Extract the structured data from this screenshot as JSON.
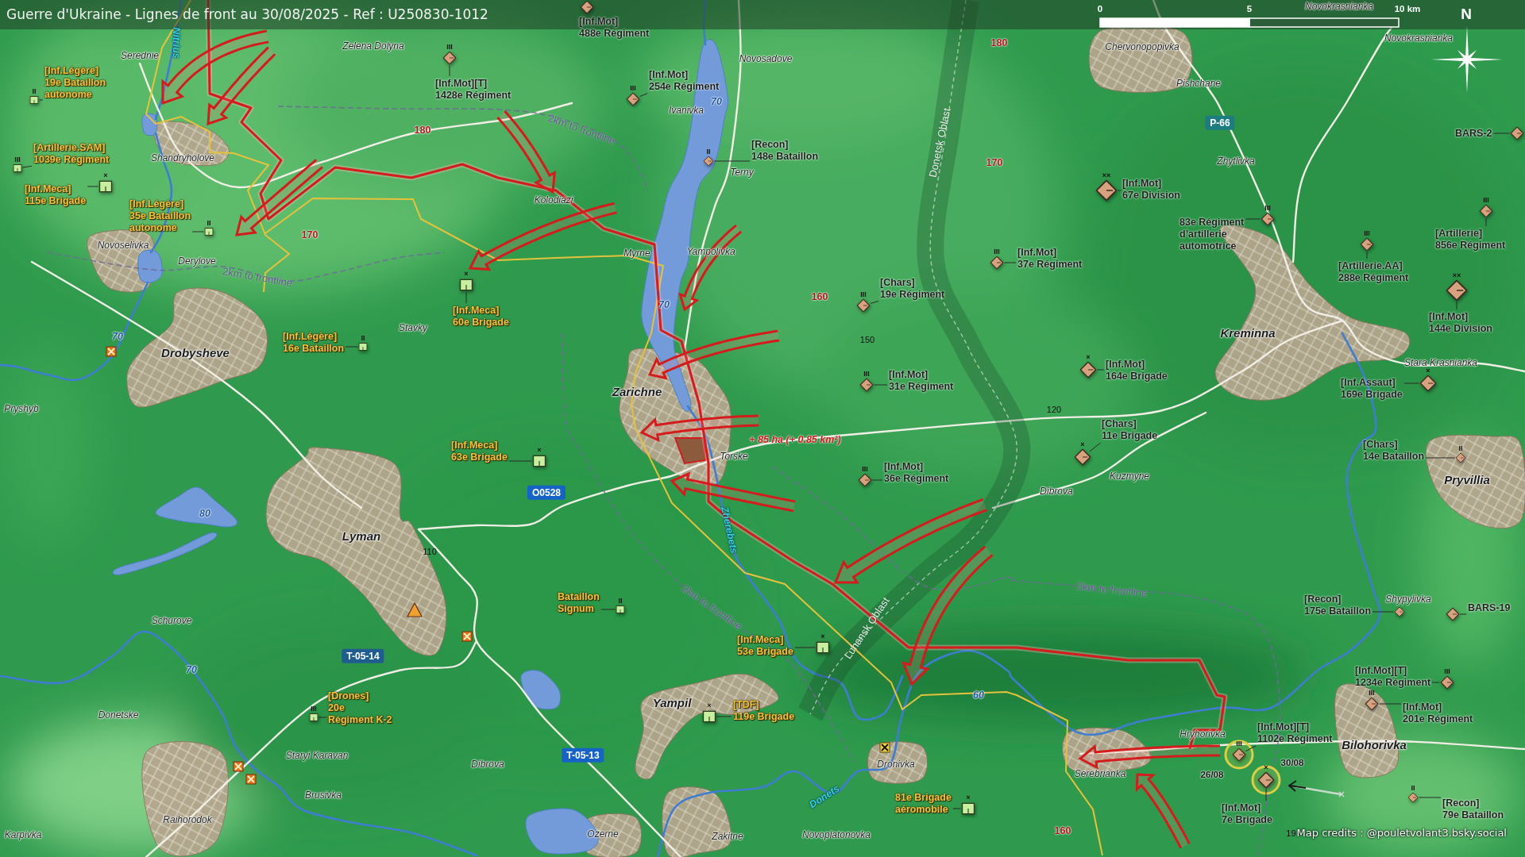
{
  "title": "Guerre d'Ukraine - Lignes de front au 30/08/2025 - Ref : U250830-1012",
  "scale_bar": {
    "ticks": [
      "0",
      "5",
      "10 km"
    ]
  },
  "compass": {
    "label": "N"
  },
  "places": [
    {
      "name": "Novokrasnianka",
      "kind": "village"
    },
    {
      "name": "Novokrasnianka",
      "kind": "village"
    },
    {
      "name": "Zelena Dolyna",
      "kind": "village"
    },
    {
      "name": "Chervonopopivka",
      "kind": "village"
    },
    {
      "name": "Serednie",
      "kind": "village"
    },
    {
      "name": "Novosadove",
      "kind": "village"
    },
    {
      "name": "Pishchane",
      "kind": "village"
    },
    {
      "name": "Ivanivka",
      "kind": "village"
    },
    {
      "name": "Shandryholove",
      "kind": "village"
    },
    {
      "name": "Zhytlivka",
      "kind": "village"
    },
    {
      "name": "Terny",
      "kind": "village"
    },
    {
      "name": "Kolodiazi",
      "kind": "village"
    },
    {
      "name": "Novoselivka",
      "kind": "village"
    },
    {
      "name": "Myrne",
      "kind": "village"
    },
    {
      "name": "Yampolivka",
      "kind": "village"
    },
    {
      "name": "Derylove",
      "kind": "village"
    },
    {
      "name": "Stavky",
      "kind": "village"
    },
    {
      "name": "Kreminna",
      "kind": "town"
    },
    {
      "name": "Drobysheve",
      "kind": "town"
    },
    {
      "name": "Stara Krasnianka",
      "kind": "village"
    },
    {
      "name": "Zarichne",
      "kind": "town"
    },
    {
      "name": "Pryshyb",
      "kind": "village"
    },
    {
      "name": "Torske",
      "kind": "village"
    },
    {
      "name": "Kuzmyne",
      "kind": "village"
    },
    {
      "name": "Pryvillia",
      "kind": "town"
    },
    {
      "name": "Dibrova",
      "kind": "village"
    },
    {
      "name": "Lyman",
      "kind": "town"
    },
    {
      "name": "Shypylivka",
      "kind": "village"
    },
    {
      "name": "Schurove",
      "kind": "village"
    },
    {
      "name": "Yampil",
      "kind": "town"
    },
    {
      "name": "Donetske",
      "kind": "village"
    },
    {
      "name": "Hryhorivka",
      "kind": "village"
    },
    {
      "name": "Bilohorivka",
      "kind": "town"
    },
    {
      "name": "Staryi Karavan",
      "kind": "village"
    },
    {
      "name": "Dibrova",
      "kind": "village"
    },
    {
      "name": "Dronivka",
      "kind": "village"
    },
    {
      "name": "Serebrianka",
      "kind": "village"
    },
    {
      "name": "Brusivka",
      "kind": "village"
    },
    {
      "name": "Raihorodok",
      "kind": "village"
    },
    {
      "name": "Karpivka",
      "kind": "village"
    },
    {
      "name": "Ozerne",
      "kind": "village"
    },
    {
      "name": "Zakitne",
      "kind": "village"
    },
    {
      "name": "Novoplatonovka",
      "kind": "village"
    }
  ],
  "russian_units": [
    {
      "kind": "medium",
      "lines": [
        "[Inf.Mot]",
        "488e Régiment"
      ],
      "highlighted": false
    },
    {
      "kind": "medium",
      "echelon": "III",
      "lines": [
        "[Inf.Mot][T]",
        "1428e Régiment"
      ],
      "highlighted": false
    },
    {
      "kind": "medium",
      "echelon": "III",
      "lines": [
        "[Inf.Mot]",
        "254e Régiment"
      ],
      "highlighted": false
    },
    {
      "kind": "medium",
      "lines": [
        "BARS-2"
      ],
      "highlighted": false
    },
    {
      "kind": "small",
      "echelon": "II",
      "lines": [
        "[Recon]",
        "148e Bataillon"
      ],
      "highlighted": false
    },
    {
      "kind": "huge",
      "echelon": "××",
      "lines": [
        "[Inf.Mot]",
        "67e Division"
      ],
      "highlighted": false
    },
    {
      "kind": "medium",
      "echelon": "III",
      "lines": [
        "83e Régiment",
        "d’artillerie",
        "automotrice"
      ],
      "highlighted": false
    },
    {
      "kind": "medium",
      "echelon": "III",
      "lines": [
        "[Artillerie]",
        "856e Régiment"
      ],
      "highlighted": false
    },
    {
      "kind": "medium",
      "echelon": "III",
      "lines": [
        "[Inf.Mot]",
        "37e Régiment"
      ],
      "highlighted": false
    },
    {
      "kind": "medium",
      "echelon": "III",
      "lines": [
        "[Artillerie.AA]",
        "288e Régiment"
      ],
      "highlighted": false
    },
    {
      "kind": "medium",
      "echelon": "III",
      "lines": [
        "[Chars]",
        "19e Régiment"
      ],
      "highlighted": false
    },
    {
      "kind": "huge",
      "echelon": "××",
      "lines": [
        "[Inf.Mot]",
        "144e Division"
      ],
      "highlighted": false
    },
    {
      "kind": "medium",
      "echelon": "III",
      "lines": [
        "[Inf.Mot]",
        "31e Régiment"
      ],
      "highlighted": false
    },
    {
      "kind": "large",
      "echelon": "×",
      "lines": [
        "[Inf.Mot]",
        "164e Brigade"
      ],
      "highlighted": false
    },
    {
      "kind": "large",
      "echelon": "×",
      "lines": [
        "[Inf.Assaut]",
        "169e Brigade"
      ],
      "highlighted": false
    },
    {
      "kind": "large",
      "echelon": "×",
      "lines": [
        "[Chars]",
        "11e Brigade"
      ],
      "highlighted": false
    },
    {
      "kind": "small",
      "echelon": "II",
      "lines": [
        "[Chars]",
        "14e Bataillon"
      ],
      "highlighted": false
    },
    {
      "kind": "medium",
      "echelon": "III",
      "lines": [
        "[Inf.Mot]",
        "36e Régiment"
      ],
      "highlighted": false
    },
    {
      "kind": "small",
      "lines": [
        "[Recon]",
        "175e Bataillon"
      ],
      "highlighted": false
    },
    {
      "kind": "medium",
      "lines": [
        "BARS-19"
      ],
      "highlighted": false
    },
    {
      "kind": "medium",
      "echelon": "III",
      "lines": [
        "[Inf.Mot][T]",
        "1234e Régiment"
      ],
      "highlighted": false
    },
    {
      "kind": "medium",
      "echelon": "III",
      "lines": [
        "[Inf.Mot]",
        "201e Régiment"
      ],
      "highlighted": false
    },
    {
      "kind": "medium",
      "echelon": "III",
      "lines": [
        "[Inf.Mot][T]",
        "1102e Régiment"
      ],
      "highlighted": true,
      "date": "26/08"
    },
    {
      "kind": "large",
      "echelon": "×",
      "lines": [
        "[Inf.Mot]",
        "7e Brigade"
      ],
      "highlighted": true,
      "date": "30/08"
    },
    {
      "kind": "small",
      "echelon": "II",
      "lines": [
        "[Recon]",
        "79e Bataillon"
      ],
      "highlighted": false
    }
  ],
  "ukrainian_units": [
    {
      "kind": "small",
      "echelon": "II",
      "lines": [
        "[Inf.Légère]",
        "19e Bataillon",
        "autonome"
      ]
    },
    {
      "kind": "small",
      "echelon": "III",
      "lines": [
        "[Artillerie.SAM]",
        "1039e Régiment"
      ]
    },
    {
      "kind": "large",
      "echelon": "×",
      "lines": [
        "[Inf.Meca]",
        "115e Brigade"
      ]
    },
    {
      "kind": "small",
      "echelon": "II",
      "lines": [
        "[Inf.Légère]",
        "35e Bataillon",
        "autonome"
      ]
    },
    {
      "kind": "large",
      "echelon": "×",
      "lines": [
        "[Inf.Meca]",
        "60e Brigade"
      ]
    },
    {
      "kind": "small",
      "echelon": "II",
      "lines": [
        "[Inf.Légère]",
        "16e Bataillon"
      ]
    },
    {
      "kind": "large",
      "echelon": "×",
      "lines": [
        "[Inf.Meca]",
        "63e Brigade"
      ]
    },
    {
      "kind": "small",
      "echelon": "II",
      "lines": [
        "Bataillon",
        "Signum"
      ]
    },
    {
      "kind": "large",
      "echelon": "×",
      "lines": [
        "[Inf.Meca]",
        "53e Brigade"
      ]
    },
    {
      "kind": "small",
      "echelon": "III",
      "lines": [
        "[Drones]",
        "20e",
        "Régiment K-2"
      ]
    },
    {
      "kind": "large",
      "echelon": "×",
      "lines": [
        "[TDF]",
        "119e Brigade"
      ]
    },
    {
      "kind": "large",
      "echelon": "×",
      "lines": [
        "81e Brigade",
        "aéromobile"
      ]
    }
  ],
  "elevations": [
    {
      "text": "180",
      "kind": "major"
    },
    {
      "text": "180",
      "kind": "major"
    },
    {
      "text": "170",
      "kind": "major"
    },
    {
      "text": "170",
      "kind": "major"
    },
    {
      "text": "160",
      "kind": "major"
    },
    {
      "text": "150",
      "kind": "minor"
    },
    {
      "text": "120",
      "kind": "minor"
    },
    {
      "text": "110",
      "kind": "minor"
    },
    {
      "text": "160",
      "kind": "major"
    },
    {
      "text": "19",
      "kind": "minor"
    }
  ],
  "water_labels": [
    "70",
    "70",
    "70",
    "80",
    "70",
    "60"
  ],
  "road_shields": [
    {
      "text": "P-66",
      "color": "#1c7c80"
    },
    {
      "text": "O0528",
      "color": "#1663c7"
    },
    {
      "text": "T-05-14",
      "color": "#1f5d8e"
    },
    {
      "text": "T-05-13",
      "color": "#1663c7"
    }
  ],
  "rivers": [
    "Nitrius",
    "Zherebets",
    "Donets"
  ],
  "oblast_labels": [
    "Donetsk Oblast",
    "Luhansk Oblast"
  ],
  "buffer_labels": [
    "2km to frontline",
    "2km to frontline",
    "2km to frontline",
    "2km to frontline"
  ],
  "gain_label": "+ 85 ha (+ 0.85 km²)",
  "credits": "Map credits : @pouletvolant3.bsky.social"
}
